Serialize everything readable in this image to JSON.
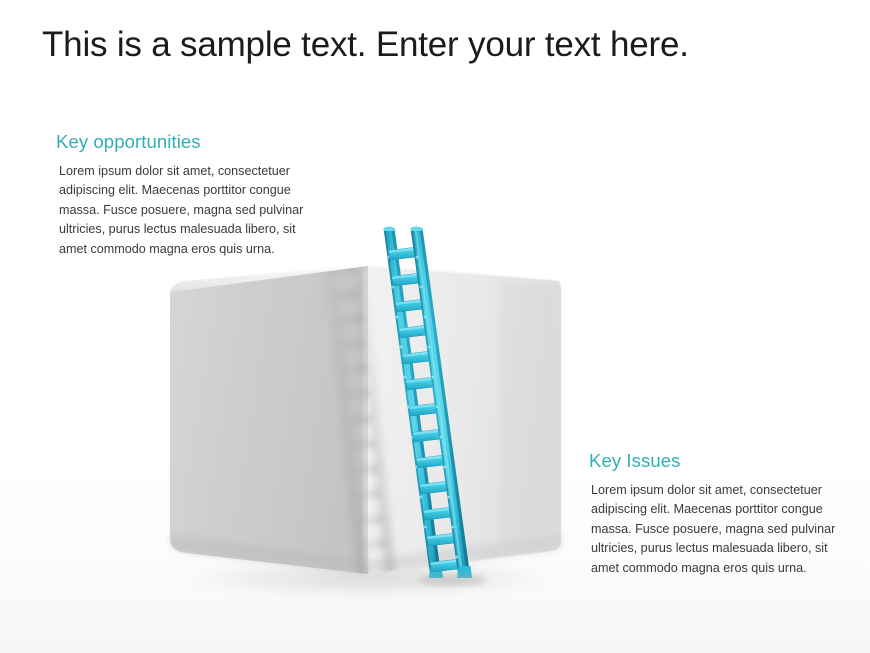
{
  "slide": {
    "title": "This is a sample text. Enter your text here.",
    "background_color": "#ffffff"
  },
  "theme": {
    "accent_color": "#31afb4",
    "ladder_color": "#3fc9e3",
    "ladder_dark_color": "#1aa7c4",
    "box_left_face_color": "#cfcfcf",
    "box_right_face_color": "#ebebeb",
    "body_text_color": "#3a3a3a",
    "title_text_color": "#1b1b1b"
  },
  "blocks": {
    "opportunities": {
      "heading": "Key opportunities",
      "body": "Lorem ipsum dolor sit amet, consectetuer adipiscing elit. Maecenas porttitor congue massa. Fusce posuere, magna sed pulvinar ultricies, purus lectus malesuada libero, sit amet commodo magna eros quis urna."
    },
    "issues": {
      "heading": "Key Issues",
      "body": "Lorem ipsum dolor sit amet, consectetuer adipiscing elit. Maecenas porttitor congue massa. Fusce posuere, magna sed pulvinar ultricies, purus lectus malesuada libero, sit amet commodo magna eros quis urna."
    }
  },
  "illustration": {
    "name": "ladder-leaning-on-box",
    "box_label": "3d-white-box",
    "ladder_label": "blue-ladder",
    "ladder_rung_count": 14,
    "shadow_label": "ladder-shadow-on-box"
  }
}
